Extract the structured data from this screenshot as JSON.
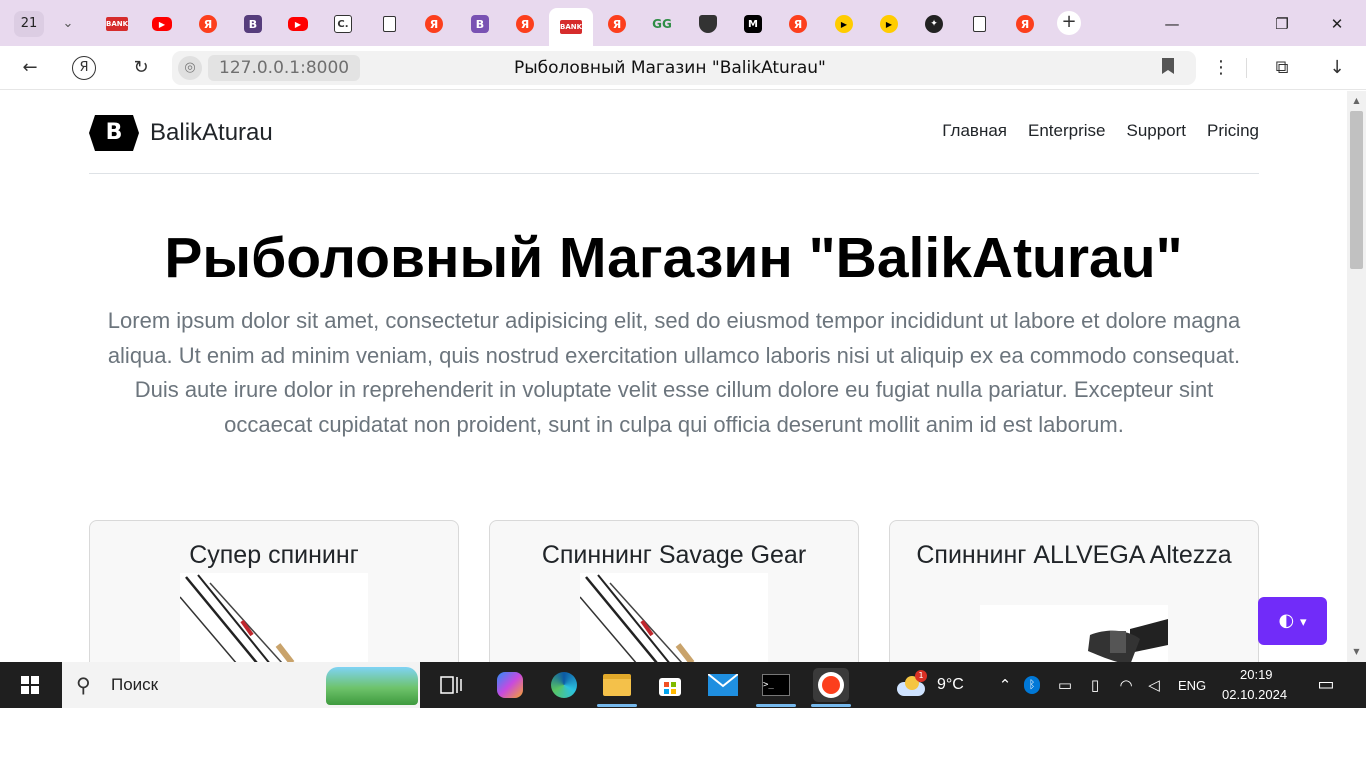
{
  "browser": {
    "tab_count": "21",
    "tab_list_glyph": "⌄",
    "new_tab_glyph": "+",
    "tabs": [
      {
        "favicon": "red-banner-icon",
        "text": "BANK"
      },
      {
        "favicon": "youtube-icon",
        "text": "▶"
      },
      {
        "favicon": "yandex-icon",
        "text": "Я"
      },
      {
        "favicon": "bootstrap-icon",
        "text": "B"
      },
      {
        "favicon": "youtube-icon",
        "text": "▶"
      },
      {
        "favicon": "c-icon",
        "text": "C."
      },
      {
        "favicon": "document-icon",
        "text": ""
      },
      {
        "favicon": "yandex-icon",
        "text": "Я"
      },
      {
        "favicon": "bootstrap-icon",
        "text": "B"
      },
      {
        "favicon": "yandex-icon",
        "text": "Я"
      },
      {
        "favicon": "red-banner-icon",
        "text": "BANK"
      },
      {
        "favicon": "yandex-icon",
        "text": "Я"
      },
      {
        "favicon": "geeksforgeeks-icon",
        "text": "GG"
      },
      {
        "favicon": "shield-icon",
        "text": ""
      },
      {
        "favicon": "medium-icon",
        "text": "M"
      },
      {
        "favicon": "yandex-icon",
        "text": "Я"
      },
      {
        "favicon": "play-icon",
        "text": "▶"
      },
      {
        "favicon": "play-icon",
        "text": "▶"
      },
      {
        "favicon": "ai-icon",
        "text": "✦"
      },
      {
        "favicon": "document-icon",
        "text": ""
      },
      {
        "favicon": "yandex-icon",
        "text": "Я"
      }
    ],
    "window_controls": {
      "minimize": "—",
      "restore": "❐",
      "close": "✕"
    },
    "nav": {
      "back": "←",
      "yandex": "Я",
      "reload": "↻",
      "menu": "⋮",
      "extensions": "⧉",
      "download": "↓"
    },
    "address": {
      "globe_icon": "◎",
      "url": "127.0.0.1:8000",
      "page_title": "Рыболовный Магазин \"BalikAturau\"",
      "bookmark_icon": "bookmark-icon"
    }
  },
  "page": {
    "brand": {
      "logo_letter": "B",
      "name": "BalikAturau"
    },
    "nav_links": [
      "Главная",
      "Enterprise",
      "Support",
      "Pricing"
    ],
    "hero": {
      "title": "Рыболовный Магазин \"BalikAturau\"",
      "lead": "Lorem ipsum dolor sit amet, consectetur adipisicing elit, sed do eiusmod tempor incididunt ut labore et dolore magna aliqua. Ut enim ad minim veniam, quis nostrud exercitation ullamco laboris nisi ut aliquip ex ea commodo consequat. Duis aute irure dolor in reprehenderit in voluptate velit esse cillum dolore eu fugiat nulla pariatur. Excepteur sint occaecat cupidatat non proident, sunt in culpa qui officia deserunt mollit anim id est laborum."
    },
    "products": [
      {
        "title": "Супер спининг",
        "image": "fishing-rod-image"
      },
      {
        "title": "Спиннинг Savage Gear",
        "image": "fishing-rod-image"
      },
      {
        "title": "Спиннинг ALLVEGA Altezza",
        "image": "fishing-reel-image"
      }
    ],
    "theme_toggle": {
      "icon": "◐",
      "caret": "▾"
    }
  },
  "taskbar": {
    "start_icon": "windows-icon",
    "search_placeholder": "Поиск",
    "search_icon": "⚲",
    "apps": [
      "task-view-icon",
      "copilot-icon",
      "edge-icon",
      "file-explorer-icon",
      "store-icon",
      "mail-icon",
      "terminal-icon",
      "yandex-browser-icon"
    ],
    "weather": {
      "temperature": "9°C",
      "badge": "1"
    },
    "language": "ENG",
    "time": "20:19",
    "date": "02.10.2024"
  },
  "colors": {
    "tab_strip": "#e8d9ee",
    "accent_purple": "#712cf9",
    "lead_gray": "#6c757d",
    "taskbar": "#1f1f1f"
  }
}
